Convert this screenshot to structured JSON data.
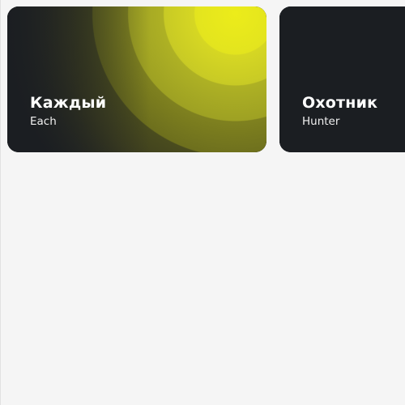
{
  "cards": [
    {
      "title": "Каждый",
      "subtitle": "Each",
      "accent": "#e8e81c"
    },
    {
      "title": "Охотник",
      "subtitle": "Hunter",
      "accent": "#a6a925"
    }
  ],
  "colors": {
    "page_background": "#f5f5f5",
    "card_background": "#1b1e22",
    "text": "#ffffff"
  }
}
